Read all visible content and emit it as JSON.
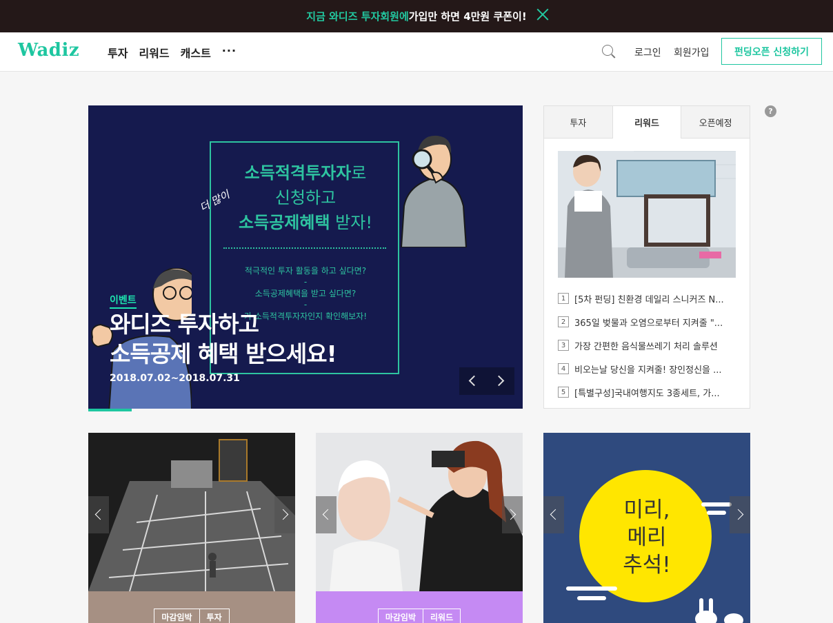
{
  "banner": {
    "text_highlight": "지금 와디즈 투자회원에",
    "text_rest": " 가입만 하면 4만원 쿠폰이!"
  },
  "header": {
    "logo": "Wadiz",
    "nav": [
      "투자",
      "리워드",
      "캐스트"
    ],
    "more": "···",
    "login": "로그인",
    "signup": "회원가입",
    "cta": "펀딩오픈 신청하기"
  },
  "hero": {
    "poster_line1_bold": "소득적격투자자",
    "poster_line1_rest": "로",
    "poster_line2": "신청하고",
    "poster_handwriting": "더 많이",
    "poster_line3_bold": "소득공제혜택",
    "poster_line3_rest": " 받자!",
    "poster_small1": "적극적인 투자 활동을 하고 싶다면?",
    "poster_dash": "-",
    "poster_small2": "소득공제혜택을 받고 싶다면?",
    "poster_small3": "가 소득적격투자자인지 확인해보자!",
    "tag": "이벤트",
    "title_line1": "와디즈 투자하고",
    "title_line2": "소득공제 혜택 받으세요!",
    "date": "2018.07.02~2018.07.31",
    "progress": 0.1
  },
  "panel": {
    "tabs": [
      "투자",
      "리워드",
      "오픈예정"
    ],
    "active_tab": "리워드",
    "ranking": [
      {
        "num": "1",
        "text": "[5차 펀딩] 친환경 데일리 스니커즈 N..."
      },
      {
        "num": "2",
        "text": "365일 벚물과 오염으로부터 지켜줄 \"..."
      },
      {
        "num": "3",
        "text": "가장 간편한 음식물쓰레기 처리 솔루션"
      },
      {
        "num": "4",
        "text": "비오는날 당신을 지켜줄! 장인정신을 ..."
      },
      {
        "num": "5",
        "text": "[특별구성]국내여행지도 3종세트, 가..."
      }
    ]
  },
  "help": "?",
  "cards": [
    {
      "badges": [
        "마감임박",
        "투자"
      ],
      "footer_color": "#a69083"
    },
    {
      "badges": [
        "마감임박",
        "리워드"
      ],
      "footer_color": "#c58af3"
    },
    {
      "text_line1": "미리,",
      "text_line2": "메리",
      "text_line3": "추석!",
      "bg_color": "#2f4a7e"
    }
  ],
  "colors": {
    "accent": "#1ec6a0",
    "banner_bg": "#241818",
    "hero_bg": "#151a4e"
  }
}
